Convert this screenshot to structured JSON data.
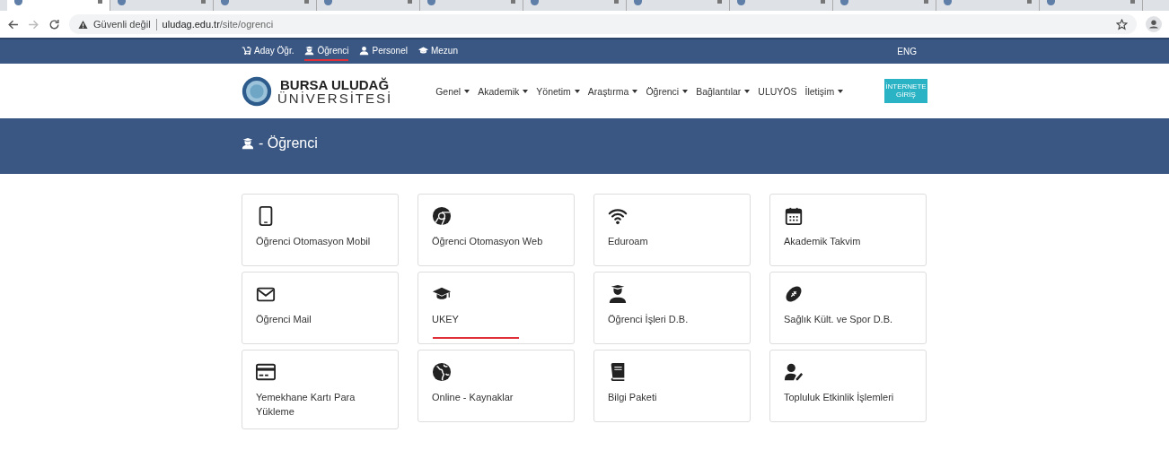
{
  "browser": {
    "tabs": [
      {
        "selected": true
      },
      {
        "selected": false
      },
      {
        "selected": false
      },
      {
        "selected": false
      },
      {
        "selected": false
      },
      {
        "selected": false
      },
      {
        "selected": false
      },
      {
        "selected": false
      },
      {
        "selected": false
      },
      {
        "selected": false
      },
      {
        "selected": false
      }
    ],
    "address": {
      "warning": "Güvenli değil",
      "host": "uludag.edu.tr",
      "path": "/site/ogrenci"
    }
  },
  "top_bar": {
    "links": [
      {
        "kind": "baby",
        "label": "Aday Öğr.",
        "selected": false
      },
      {
        "kind": "student",
        "label": "Öğrenci",
        "selected": true
      },
      {
        "kind": "user",
        "label": "Personel",
        "selected": false
      },
      {
        "kind": "cap",
        "label": "Mezun",
        "selected": false
      }
    ],
    "language": "ENG"
  },
  "header": {
    "logo_line1": "BURSA ULUDAĞ",
    "logo_line2": "ÜNİVERSİTESİ",
    "nav": [
      {
        "label": "Genel",
        "dropdown": true
      },
      {
        "label": "Akademik",
        "dropdown": true
      },
      {
        "label": "Yönetim",
        "dropdown": true
      },
      {
        "label": "Araştırma",
        "dropdown": true
      },
      {
        "label": "Öğrenci",
        "dropdown": true
      },
      {
        "label": "Bağlantılar",
        "dropdown": true
      },
      {
        "label": "ULUYÖS",
        "dropdown": false
      },
      {
        "label": "İletişim",
        "dropdown": true
      }
    ],
    "button": {
      "line1": "İNTERNETE",
      "line2": "GİRİŞ"
    }
  },
  "banner": {
    "title": "- Öğrenci"
  },
  "cards": [
    {
      "kind": "phone",
      "label": "Öğrenci Otomasyon Mobil",
      "selected": false
    },
    {
      "kind": "chrome",
      "label": "Öğrenci Otomasyon Web",
      "selected": false
    },
    {
      "kind": "wifi",
      "label": "Eduroam",
      "selected": false
    },
    {
      "kind": "calendar",
      "label": "Akademik Takvim",
      "selected": false
    },
    {
      "kind": "mail",
      "label": "Öğrenci Mail",
      "selected": false
    },
    {
      "kind": "cap",
      "label": "UKEY",
      "selected": true
    },
    {
      "kind": "student",
      "label": "Öğrenci İşleri D.B.",
      "selected": false
    },
    {
      "kind": "football",
      "label": "Sağlık Kült. ve Spor D.B.",
      "selected": false
    },
    {
      "kind": "card",
      "label": "Yemekhane Kartı Para Yükleme",
      "selected": false
    },
    {
      "kind": "globe",
      "label": "Online - Kaynaklar",
      "selected": false
    },
    {
      "kind": "book",
      "label": "Bilgi Paketi",
      "selected": false
    },
    {
      "kind": "useredit",
      "label": "Topluluk Etkinlik İşlemleri",
      "selected": false
    }
  ]
}
